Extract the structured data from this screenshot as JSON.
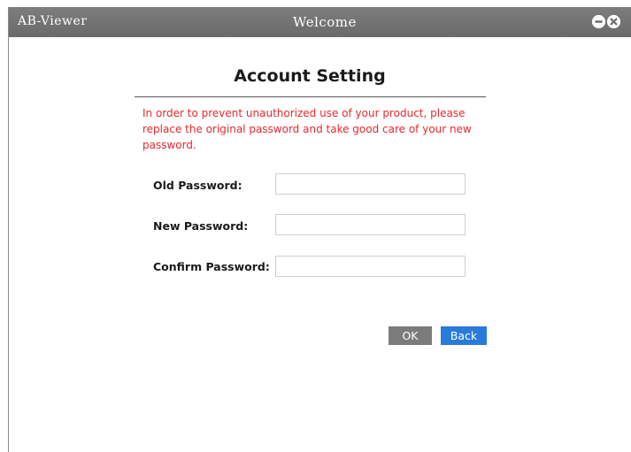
{
  "titlebar": {
    "app_name": "AB-Viewer",
    "title": "Welcome",
    "minimize_icon": "minus-circle-icon",
    "close_icon": "close-circle-icon"
  },
  "form": {
    "heading": "Account Setting",
    "notice": "In order to prevent unauthorized use of your product, please replace the original password and take good care of your new password.",
    "notice_color": "#e8282e",
    "fields": [
      {
        "label": "Old Password:",
        "value": "",
        "placeholder": ""
      },
      {
        "label": "New Password:",
        "value": "",
        "placeholder": ""
      },
      {
        "label": "Confirm Password:",
        "value": "",
        "placeholder": ""
      }
    ]
  },
  "buttons": {
    "ok_label": "OK",
    "back_label": "Back",
    "ok_color": "#7b7b7b",
    "back_color": "#2a7ad9"
  }
}
